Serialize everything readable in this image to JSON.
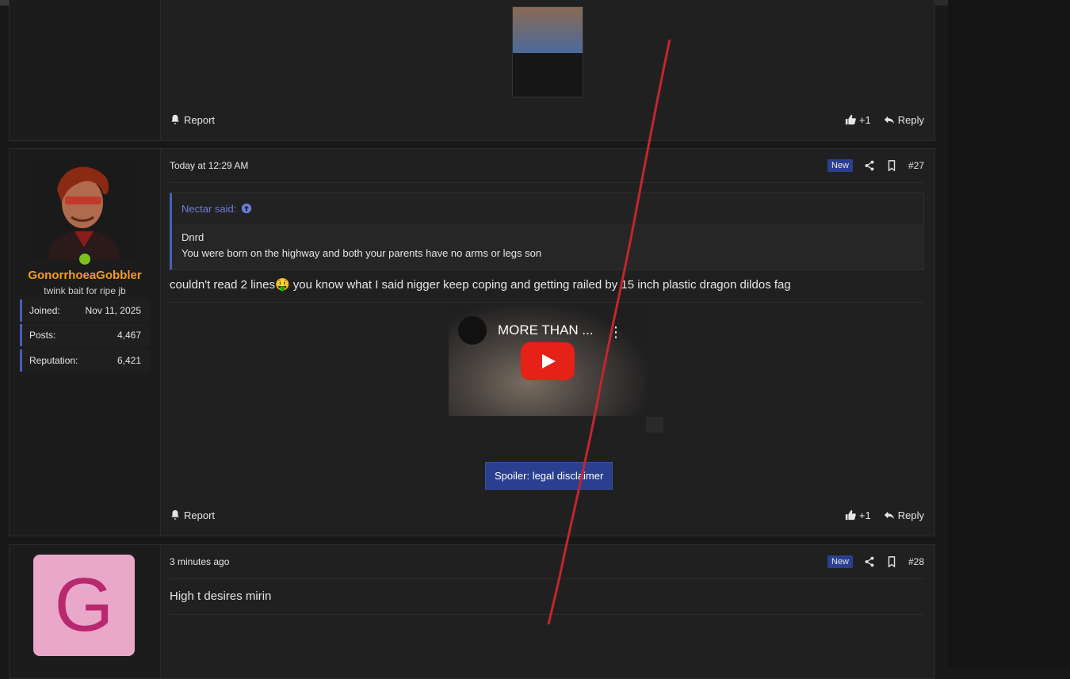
{
  "colors": {
    "accent": "#4b5fb8",
    "username": "#f39c1e",
    "new_badge": "#2a3f8f",
    "online": "#7cc41b"
  },
  "post_prev": {
    "report_label": "Report",
    "like_count": "+1",
    "reply_label": "Reply"
  },
  "post27": {
    "user": {
      "name": "GonorrhoeaGobbler",
      "title": "twink bait for ripe jb",
      "stats": [
        {
          "label": "Joined:",
          "value": "Nov 11, 2025"
        },
        {
          "label": "Posts:",
          "value": "4,467"
        },
        {
          "label": "Reputation:",
          "value": "6,421"
        }
      ]
    },
    "time": "Today at 12:29 AM",
    "badge": "New",
    "number": "#27",
    "quote": {
      "author": "Nectar said:",
      "lines": [
        "Dnrd",
        "You were born on the highway and both your parents have no arms or legs son"
      ]
    },
    "text_before": "couldn't read 2 lines",
    "emoji": "🤑",
    "text_after": " you know what I said nigger keep coping and getting railed by 15 inch plastic dragon dildos fag",
    "video_title": "MORE THAN ...",
    "spoiler_label": "Spoiler: legal disclaimer",
    "report_label": "Report",
    "like_count": "+1",
    "reply_label": "Reply"
  },
  "post28": {
    "user": {
      "avatar_letter": "G"
    },
    "time": "3 minutes ago",
    "badge": "New",
    "number": "#28",
    "text": "High t desires mirin"
  }
}
